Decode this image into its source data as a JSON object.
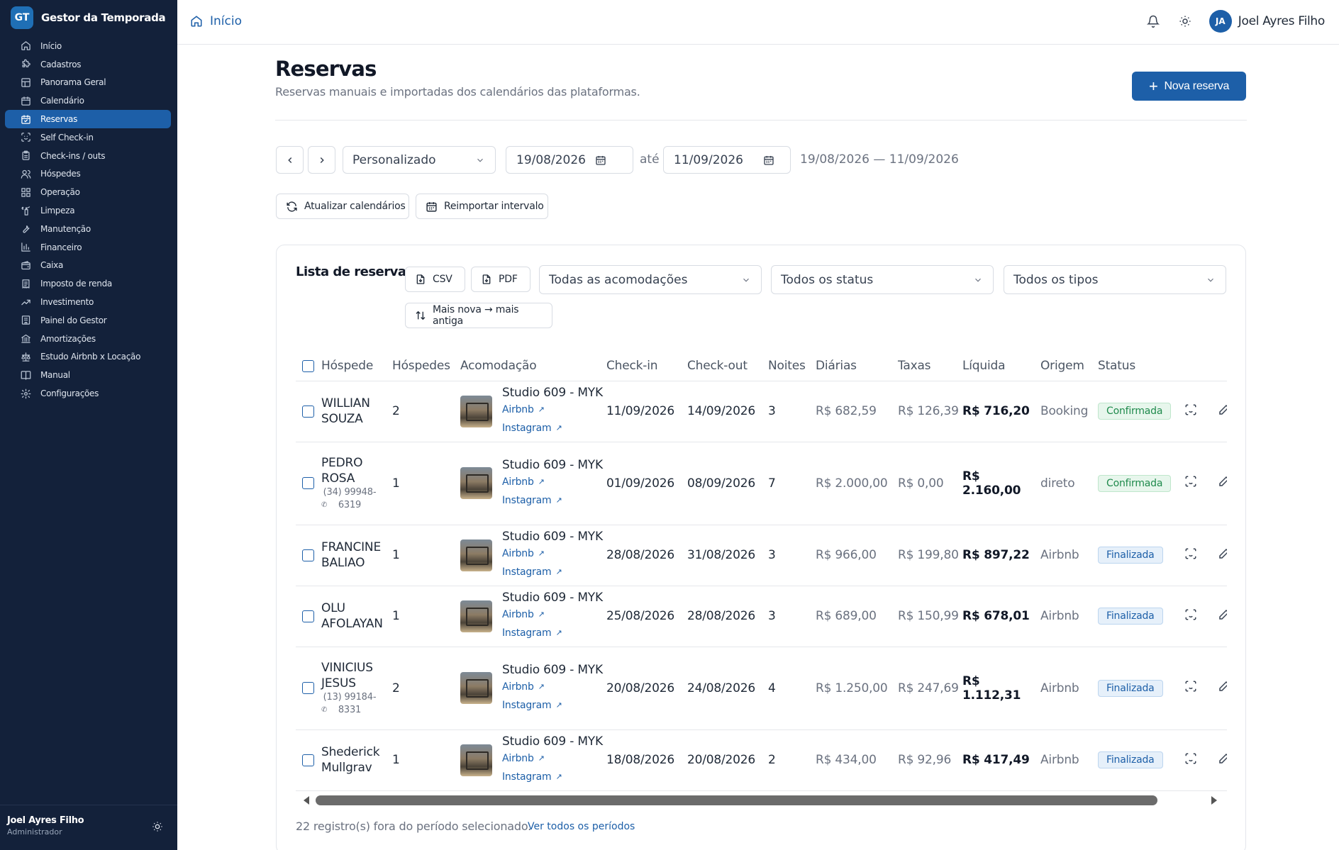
{
  "brand": {
    "logo": "GT",
    "name": "Gestor da Temporada"
  },
  "sidebar": {
    "items": [
      {
        "label": "Início",
        "icon": "home-icon"
      },
      {
        "label": "Cadastros",
        "icon": "puzzle-icon"
      },
      {
        "label": "Panorama Geral",
        "icon": "layout-icon"
      },
      {
        "label": "Calendário",
        "icon": "calendar-icon"
      },
      {
        "label": "Reservas",
        "icon": "calendar-check-icon",
        "active": true
      },
      {
        "label": "Self Check-in",
        "icon": "scan-face-icon"
      },
      {
        "label": "Check-ins / outs",
        "icon": "clipboard-icon"
      },
      {
        "label": "Hóspedes",
        "icon": "users-icon"
      },
      {
        "label": "Operação",
        "icon": "grid-icon"
      },
      {
        "label": "Limpeza",
        "icon": "spray-icon"
      },
      {
        "label": "Manutenção",
        "icon": "wrench-icon"
      },
      {
        "label": "Financeiro",
        "icon": "bar-chart-icon"
      },
      {
        "label": "Caixa",
        "icon": "wallet-icon"
      },
      {
        "label": "Imposto de renda",
        "icon": "receipt-icon"
      },
      {
        "label": "Investimento",
        "icon": "trending-up-icon"
      },
      {
        "label": "Painel do Gestor",
        "icon": "building-icon"
      },
      {
        "label": "Amortizações",
        "icon": "bank-icon"
      },
      {
        "label": "Estudo Airbnb x Locação",
        "icon": "scale-icon"
      },
      {
        "label": "Manual",
        "icon": "book-icon"
      },
      {
        "label": "Configurações",
        "icon": "gear-icon"
      }
    ],
    "footer": {
      "name": "Joel Ayres Filho",
      "role": "Administrador"
    }
  },
  "topbar": {
    "breadcrumb": "Início",
    "avatar": "JA",
    "user": "Joel Ayres Filho"
  },
  "page": {
    "title": "Reservas",
    "subtitle": "Reservas manuais e importadas dos calendários das plataformas.",
    "new_button": "Nova reserva"
  },
  "filters": {
    "period": "Personalizado",
    "from": "19/08/2026",
    "to_label": "até",
    "to": "11/09/2026",
    "range_text": "19/08/2026 — 11/09/2026",
    "refresh": "Atualizar calendários",
    "reimport": "Reimportar intervalo"
  },
  "list": {
    "title": "Lista de reservas",
    "csv": "CSV",
    "pdf": "PDF",
    "accommodation_filter": "Todas as acomodações",
    "status_filter": "Todos os status",
    "type_filter": "Todos os tipos",
    "sort": "Mais nova → mais antiga",
    "columns": [
      "Hóspede",
      "Hóspedes",
      "Acomodação",
      "Check-in",
      "Check-out",
      "Noites",
      "Diárias",
      "Taxas",
      "Líquida",
      "Origem",
      "Status"
    ],
    "link_airbnb": "Airbnb",
    "link_instagram": "Instagram",
    "rows": [
      {
        "guest": "WILLIAN SOUZA",
        "phone": "",
        "guests": "2",
        "accommodation": "Studio 609 - MYK",
        "checkin": "11/09/2026",
        "checkout": "14/09/2026",
        "nights": "3",
        "daily": "R$ 682,59",
        "fees": "R$ 126,39",
        "net": "R$ 716,20",
        "origin": "Booking",
        "status": "Confirmada",
        "status_kind": "ok"
      },
      {
        "guest": "PEDRO ROSA",
        "phone": "(34) 99948-6319",
        "guests": "1",
        "accommodation": "Studio 609 - MYK",
        "checkin": "01/09/2026",
        "checkout": "08/09/2026",
        "nights": "7",
        "daily": "R$ 2.000,00",
        "fees": "R$ 0,00",
        "net": "R$ 2.160,00",
        "origin": "direto",
        "status": "Confirmada",
        "status_kind": "ok"
      },
      {
        "guest": "FRANCINE BALIAO",
        "phone": "",
        "guests": "1",
        "accommodation": "Studio 609 - MYK",
        "checkin": "28/08/2026",
        "checkout": "31/08/2026",
        "nights": "3",
        "daily": "R$ 966,00",
        "fees": "R$ 199,80",
        "net": "R$ 897,22",
        "origin": "Airbnb",
        "status": "Finalizada",
        "status_kind": "fin"
      },
      {
        "guest": "OLU AFOLAYAN",
        "phone": "",
        "guests": "1",
        "accommodation": "Studio 609 - MYK",
        "checkin": "25/08/2026",
        "checkout": "28/08/2026",
        "nights": "3",
        "daily": "R$ 689,00",
        "fees": "R$ 150,99",
        "net": "R$ 678,01",
        "origin": "Airbnb",
        "status": "Finalizada",
        "status_kind": "fin"
      },
      {
        "guest": "VINICIUS JESUS",
        "phone": "(13) 99184-8331",
        "guests": "2",
        "accommodation": "Studio 609 - MYK",
        "checkin": "20/08/2026",
        "checkout": "24/08/2026",
        "nights": "4",
        "daily": "R$ 1.250,00",
        "fees": "R$ 247,69",
        "net": "R$ 1.112,31",
        "origin": "Airbnb",
        "status": "Finalizada",
        "status_kind": "fin"
      },
      {
        "guest": "Shederick Mullgrav",
        "phone": "",
        "guests": "1",
        "accommodation": "Studio 609 - MYK",
        "checkin": "18/08/2026",
        "checkout": "20/08/2026",
        "nights": "2",
        "daily": "R$ 434,00",
        "fees": "R$ 92,96",
        "net": "R$ 417,49",
        "origin": "Airbnb",
        "status": "Finalizada",
        "status_kind": "fin"
      }
    ],
    "footer_text": "22 registro(s) fora do período selecionado.",
    "footer_link": "Ver todos os períodos"
  }
}
